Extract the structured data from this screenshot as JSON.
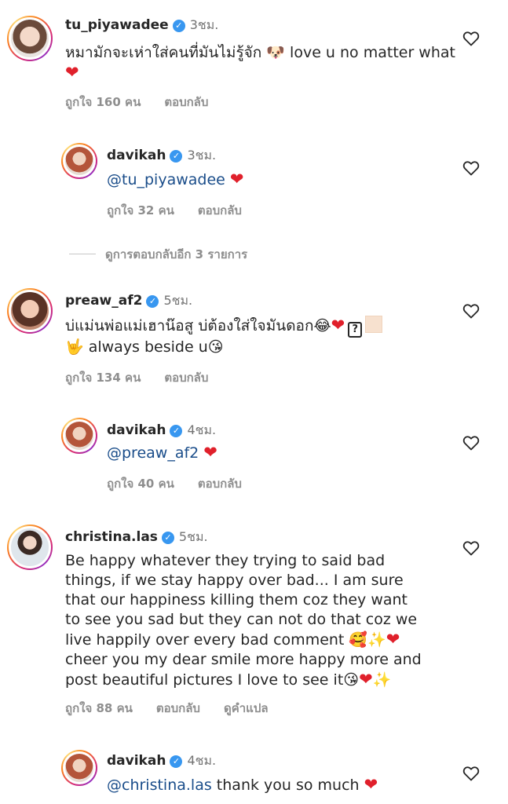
{
  "comments": [
    {
      "username": "tu_piyawadee",
      "time": "3ชม.",
      "text_parts": [
        "หมามักจะเห่าใส่คนที่มันไม่รู้จัก ",
        " love u no matter what "
      ],
      "likes": "ถูกใจ 160 คน",
      "reply": "ตอบกลับ"
    },
    {
      "username": "davikah",
      "time": "3ชม.",
      "mention": "@tu_piyawadee",
      "likes": "ถูกใจ 32 คน",
      "reply": "ตอบกลับ"
    },
    {
      "username": "preaw_af2",
      "time": "5ชม.",
      "text_parts": [
        "บ่แม่นพ่อแม่เฮาน๊อสู บ่ต้องใส่ใจมันดอก",
        "?",
        " always beside u"
      ],
      "likes": "ถูกใจ 134 คน",
      "reply": "ตอบกลับ"
    },
    {
      "username": "davikah",
      "time": "4ชม.",
      "mention": "@preaw_af2",
      "likes": "ถูกใจ 40 คน",
      "reply": "ตอบกลับ"
    },
    {
      "username": "christina.las",
      "time": "5ชม.",
      "text_lines": [
        "Be happy whatever they trying to said bad",
        "things, if we stay happy over bad... I am sure",
        "that our happiness killing them coz they want",
        "to see you sad but they can not do that coz we",
        "live happily over every bad comment ",
        "cheer you my dear smile more happy more and",
        "post beautiful pictures I love to see it"
      ],
      "likes": "ถูกใจ 88 คน",
      "reply": "ตอบกลับ",
      "translate": "ดูคำแปล"
    },
    {
      "username": "davikah",
      "time": "4ชม.",
      "mention": "@christina.las",
      "text_after": " thank you so much "
    }
  ],
  "view_more_replies": "ดูการตอบกลับอีก 3 รายการ",
  "icons": {
    "verified": "verified-badge-icon",
    "like": "heart-outline-icon"
  },
  "colors": {
    "verified": "#3897f0",
    "mention": "#1a4d8a",
    "meta": "#8e8e8e",
    "heart": "#e0202b"
  }
}
